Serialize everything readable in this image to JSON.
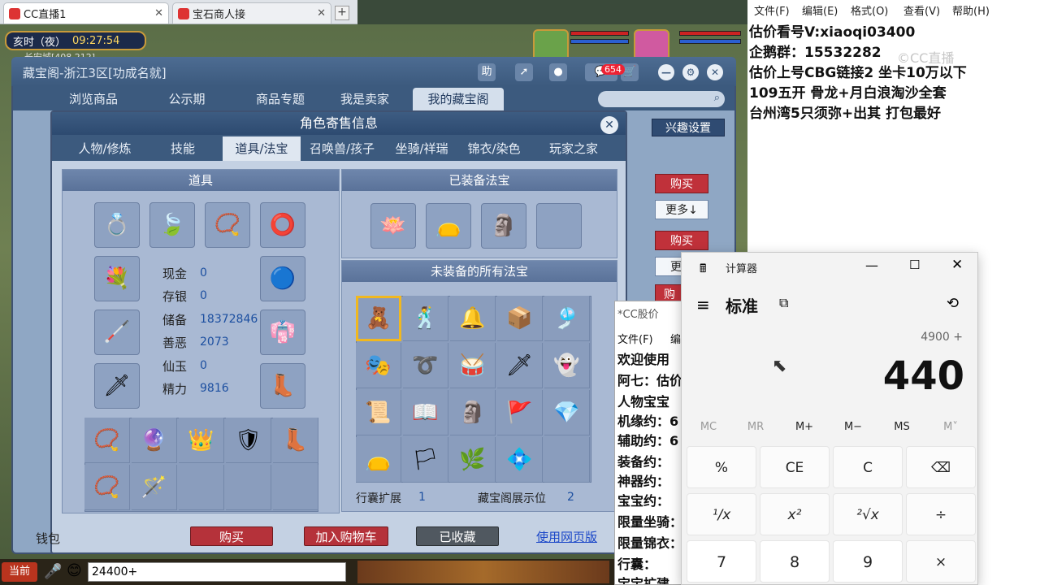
{
  "browser": {
    "tabs": [
      {
        "label": "CC直播1"
      },
      {
        "label": "宝石商人接"
      }
    ],
    "close": "✕",
    "new": "+"
  },
  "game": {
    "time_label": "亥时（夜）",
    "time": "09:27:54",
    "location": "长安城[408,212]",
    "window": {
      "title": "藏宝阁-浙江3区[功成名就]",
      "icons": {
        "help": "助",
        "share": "➚",
        "record": "●",
        "chat_count": "654"
      }
    },
    "nav_tabs": [
      "浏览商品",
      "公示期",
      "商品专题",
      "我是卖家",
      "我的藏宝阁"
    ],
    "interest": "兴趣设置",
    "side": {
      "buy": "购买",
      "more": "更多↓",
      "more2": "更多",
      "buy2": "购"
    },
    "dialog": {
      "title": "角色寄售信息",
      "close": "✕",
      "tabs": [
        "人物/修炼",
        "技能",
        "道具/法宝",
        "召唤兽/孩子",
        "坐骑/祥瑞",
        "锦衣/染色",
        "玩家之家"
      ],
      "items_header": "道具",
      "equipped_header": "已装备法宝",
      "unequipped_header": "未装备的所有法宝",
      "stats": [
        {
          "label": "现金",
          "value": "0"
        },
        {
          "label": "存银",
          "value": "0"
        },
        {
          "label": "储备",
          "value": "18372846"
        },
        {
          "label": "善恶",
          "value": "2073"
        },
        {
          "label": "仙玉",
          "value": "0"
        },
        {
          "label": "精力",
          "value": "9816"
        }
      ],
      "bag_expand_label": "行囊扩展",
      "bag_expand_value": "1",
      "display_label": "藏宝阁展示位",
      "display_value": "2",
      "buttons": {
        "buy": "购买",
        "add_cart": "加入购物车",
        "collected": "已收藏",
        "web": "使用网页版"
      }
    },
    "money_label": "钱包",
    "chat": {
      "channel": "当前",
      "input": "24400+"
    }
  },
  "notepad": {
    "menu": [
      "文件(F)",
      "编辑(E)",
      "格式(O)",
      "查看(V)",
      "帮助(H)"
    ],
    "lines": [
      "估价看号V:xiaoqi03400",
      "企鹅群：15532282",
      "估价上号CBG链接2  坐卡10万以下",
      "109五开 骨龙+月白浪淘沙全套",
      "台州湾5只须弥+出其 打包最好"
    ],
    "watermark": "©CC直播"
  },
  "notepad2": {
    "title": "*CC股价",
    "menu": [
      "文件(F)",
      "编"
    ],
    "lines": [
      "欢迎使用",
      "阿七：估价",
      "人物宝宝",
      "机缘约：6",
      "辅助约：6",
      "装备约：",
      "神器约：",
      "宝宝约：",
      "限量坐骑：",
      "限量锦衣：",
      "行囊：",
      "宝宝扩建"
    ]
  },
  "calculator": {
    "title": "计算器",
    "mode": "标准",
    "expression": "4900 +",
    "display": "440",
    "memory": [
      "MC",
      "MR",
      "M+",
      "M−",
      "MS",
      "M˅"
    ],
    "rows": [
      [
        "%",
        "CE",
        "C",
        "⌫"
      ],
      [
        "¹/x",
        "x²",
        "²√x",
        "÷"
      ],
      [
        "7",
        "8",
        "9",
        "×"
      ]
    ]
  }
}
